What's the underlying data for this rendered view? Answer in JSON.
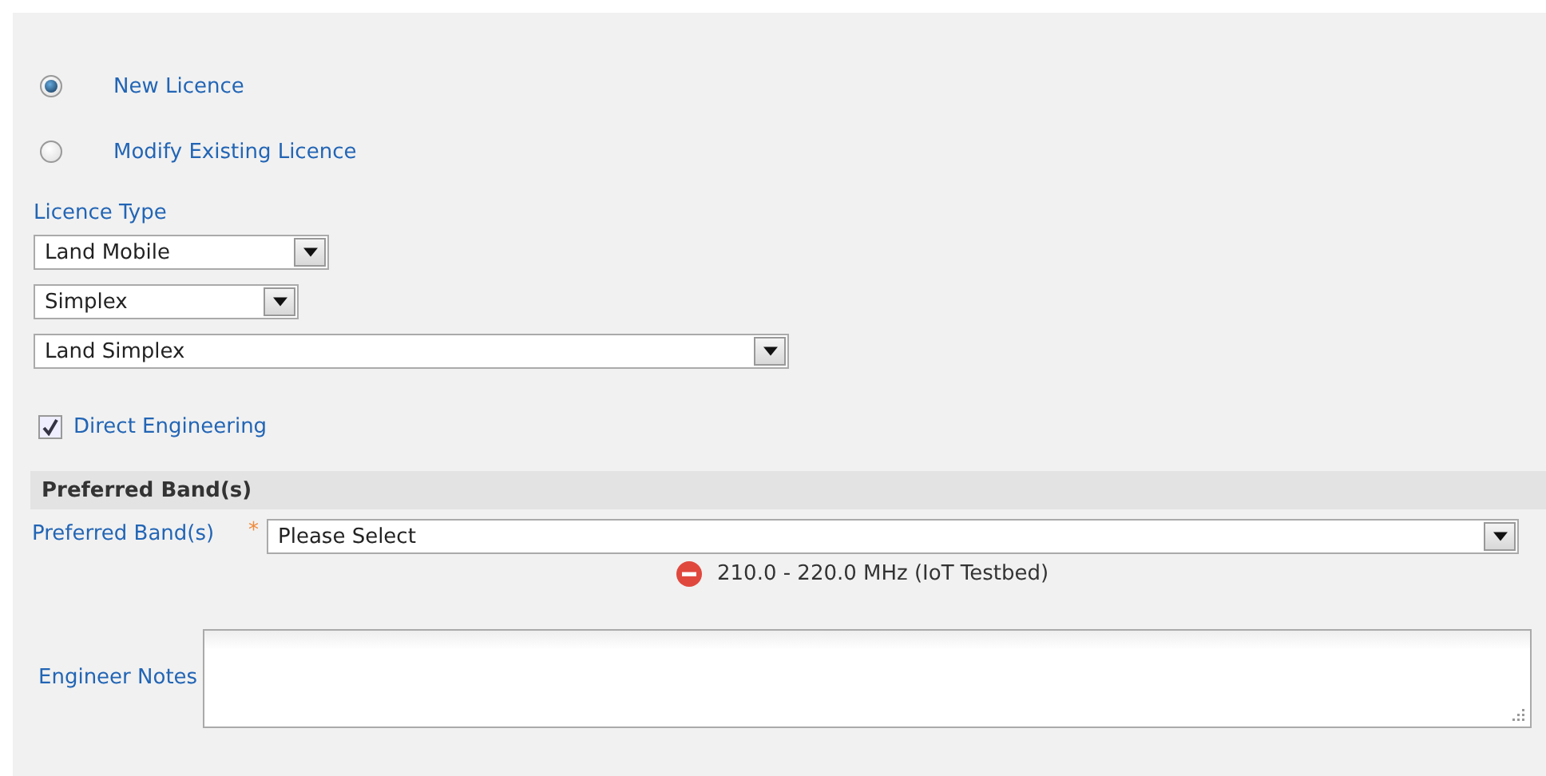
{
  "licence_options": [
    {
      "label": "New Licence",
      "selected": true
    },
    {
      "label": "Modify Existing Licence",
      "selected": false
    }
  ],
  "licence_type": {
    "label": "Licence Type",
    "selects": [
      {
        "value": "Land Mobile"
      },
      {
        "value": "Simplex"
      },
      {
        "value": "Land Simplex"
      }
    ]
  },
  "direct_engineering": {
    "label": "Direct Engineering",
    "checked": true
  },
  "section": {
    "title": "Preferred Band(s)"
  },
  "preferred_band": {
    "label": "Preferred Band(s)",
    "required": true,
    "required_mark": "*",
    "placeholder": "Please Select",
    "chosen": [
      "210.0 - 220.0 MHz (IoT Testbed)"
    ]
  },
  "engineer_notes": {
    "label": "Engineer Notes"
  }
}
